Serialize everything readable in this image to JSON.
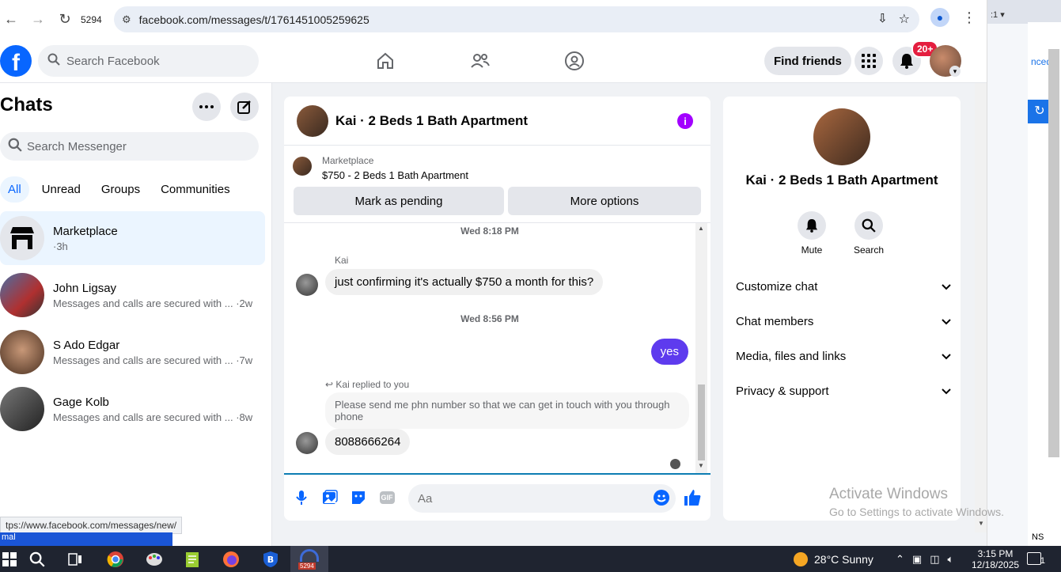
{
  "browser": {
    "tab_count": "5294",
    "url": "facebook.com/messages/t/1761451005259625",
    "status_url": "tps://www.facebook.com/messages/new/"
  },
  "bg_window": {
    "top_text": ":1 ▾",
    "link_text": "nced",
    "bottom_text": "NS"
  },
  "header": {
    "search_placeholder": "Search Facebook",
    "find_friends": "Find friends",
    "notif_count": "20+"
  },
  "sidebar": {
    "title": "Chats",
    "search_placeholder": "Search Messenger",
    "filters": [
      "All",
      "Unread",
      "Groups",
      "Communities"
    ],
    "chats": [
      {
        "name": "Marketplace",
        "sub": "·3h"
      },
      {
        "name": "John Ligsay",
        "sub": "Messages and calls are secured with ... ·2w"
      },
      {
        "name": "S Ado Edgar",
        "sub": "Messages and calls are secured with ... ·7w"
      },
      {
        "name": "Gage Kolb",
        "sub": "Messages and calls are secured with ... ·8w"
      }
    ]
  },
  "conversation": {
    "title": "Kai · 2 Beds 1 Bath Apartment",
    "marketplace_label": "Marketplace",
    "listing": "$750 - 2 Beds 1 Bath Apartment",
    "btn_pending": "Mark as pending",
    "btn_more": "More options",
    "ts1": "Wed 8:18 PM",
    "sender": "Kai",
    "msg1": "just confirming it's actually $750 a month for this?",
    "ts2": "Wed 8:56 PM",
    "msg_out": "yes",
    "replied": "Kai replied to you",
    "quoted": "Please send me  phn  number so that we can get in touch with you through phone",
    "msg2": "8088666264",
    "composer_placeholder": "Aa",
    "gif_label": "GIF"
  },
  "right_panel": {
    "title": "Kai · 2 Beds 1 Bath Apartment",
    "mute": "Mute",
    "search": "Search",
    "rows": [
      "Customize chat",
      "Chat members",
      "Media, files and links",
      "Privacy & support"
    ]
  },
  "watermark": {
    "line1": "Activate Windows",
    "line2": "Go to Settings to activate Windows."
  },
  "taskbar": {
    "blue_strip": "mal",
    "active_badge": "5294",
    "weather": "28°C  Sunny",
    "time": "3:15 PM",
    "date": "12/18/2025",
    "notif": "1"
  },
  "colors": {
    "fb_blue": "#0866ff",
    "outgoing_bubble": "#5e3bee",
    "badge_red": "#e41e3f"
  }
}
